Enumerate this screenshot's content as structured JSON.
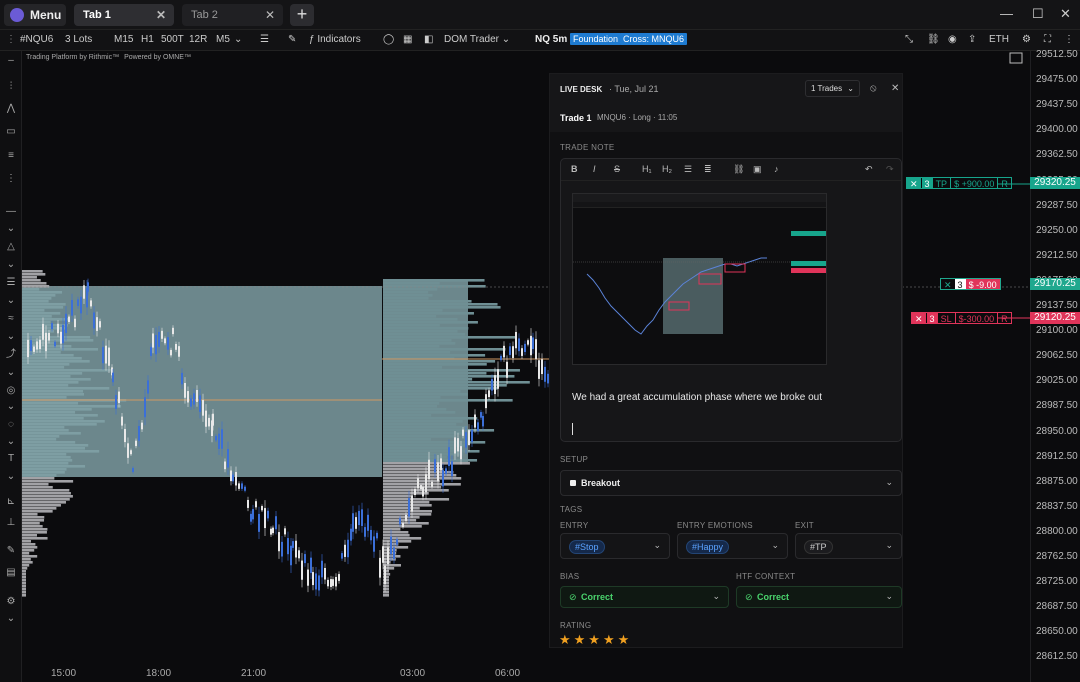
{
  "titlebar": {
    "menu_label": "Menu",
    "tabs": [
      {
        "label": "Tab 1",
        "active": true
      },
      {
        "label": "Tab 2",
        "active": false
      }
    ],
    "add_tab": "+",
    "window_controls": {
      "minimize": "—",
      "maximize": "☐",
      "close": "✕"
    }
  },
  "toolbar": {
    "symbol": "#NQU6",
    "lots": "3 Lots",
    "timeframes": [
      "M15",
      "H1",
      "500T",
      "12R",
      "M5"
    ],
    "indicators_label": "Indicators",
    "dom_trader_label": "DOM Trader",
    "chart_label": "NQ 5m",
    "badge_foundation": "Foundation",
    "badge_cross": "Cross: MNQU6",
    "session_label": "ETH"
  },
  "chart": {
    "watermark": "Trading Platform by Rithmic™",
    "watermark2": "Powered by OMNE™",
    "y_ticks": [
      "29512.50",
      "29475.00",
      "29437.50",
      "29400.00",
      "29362.50",
      "29325.00",
      "29287.50",
      "29250.00",
      "29212.50",
      "29175.00",
      "29137.50",
      "29100.00",
      "29062.50",
      "29025.00",
      "28987.50",
      "28950.00",
      "28912.50",
      "28875.00",
      "28837.50",
      "28800.00",
      "28762.50",
      "28725.00",
      "28687.50",
      "28650.00",
      "28612.50"
    ],
    "x_ticks": [
      "15:00",
      "18:00",
      "21:00",
      "03:00",
      "06:00"
    ],
    "price_labels": {
      "tp_price": "29320.25",
      "current_price": "29170.25",
      "sl_price": "29120.25"
    },
    "orders": {
      "tp": {
        "qty": "3",
        "type": "TP",
        "pnl": "$ +900.00",
        "r": "R",
        "color": "#17a58c"
      },
      "position": {
        "qty": "3",
        "pnl": "$ -9.00",
        "color": "#1fa88e"
      },
      "sl": {
        "qty": "3",
        "type": "SL",
        "pnl": "$-300.00",
        "r": "R",
        "color": "#e0345a"
      }
    },
    "colors": {
      "up": "#3b6fd8",
      "down": "#e8e8e8",
      "profile_left": "#7e9ea3",
      "profile_right": "#a2a2a6",
      "poc": "#d19862"
    }
  },
  "live_desk": {
    "title": "LIVE DESK",
    "date": "· Tue, Jul 21",
    "trades_dropdown": "1 Trades",
    "trade_title": "Trade 1",
    "trade_meta": "MNQU6 · Long · 11:05",
    "trade_note_label": "TRADE NOTE",
    "editor_tools": [
      "B",
      "I",
      "S",
      "H₁",
      "H₂"
    ],
    "note_text": "We had a great accumulation phase where we broke out",
    "setup_label": "SETUP",
    "setup_value": "Breakout",
    "tags_label": "TAGS",
    "entry_label": "ENTRY",
    "entry_value": "#Stop",
    "entry_emotions_label": "ENTRY EMOTIONS",
    "entry_emotions_value": "#Happy",
    "exit_label": "EXIT",
    "exit_value": "#TP",
    "bias_label": "BIAS",
    "bias_value": "Correct",
    "htf_label": "HTF CONTEXT",
    "htf_value": "Correct",
    "rating_label": "RATING",
    "rating": 5,
    "stars": "★★★★★"
  }
}
